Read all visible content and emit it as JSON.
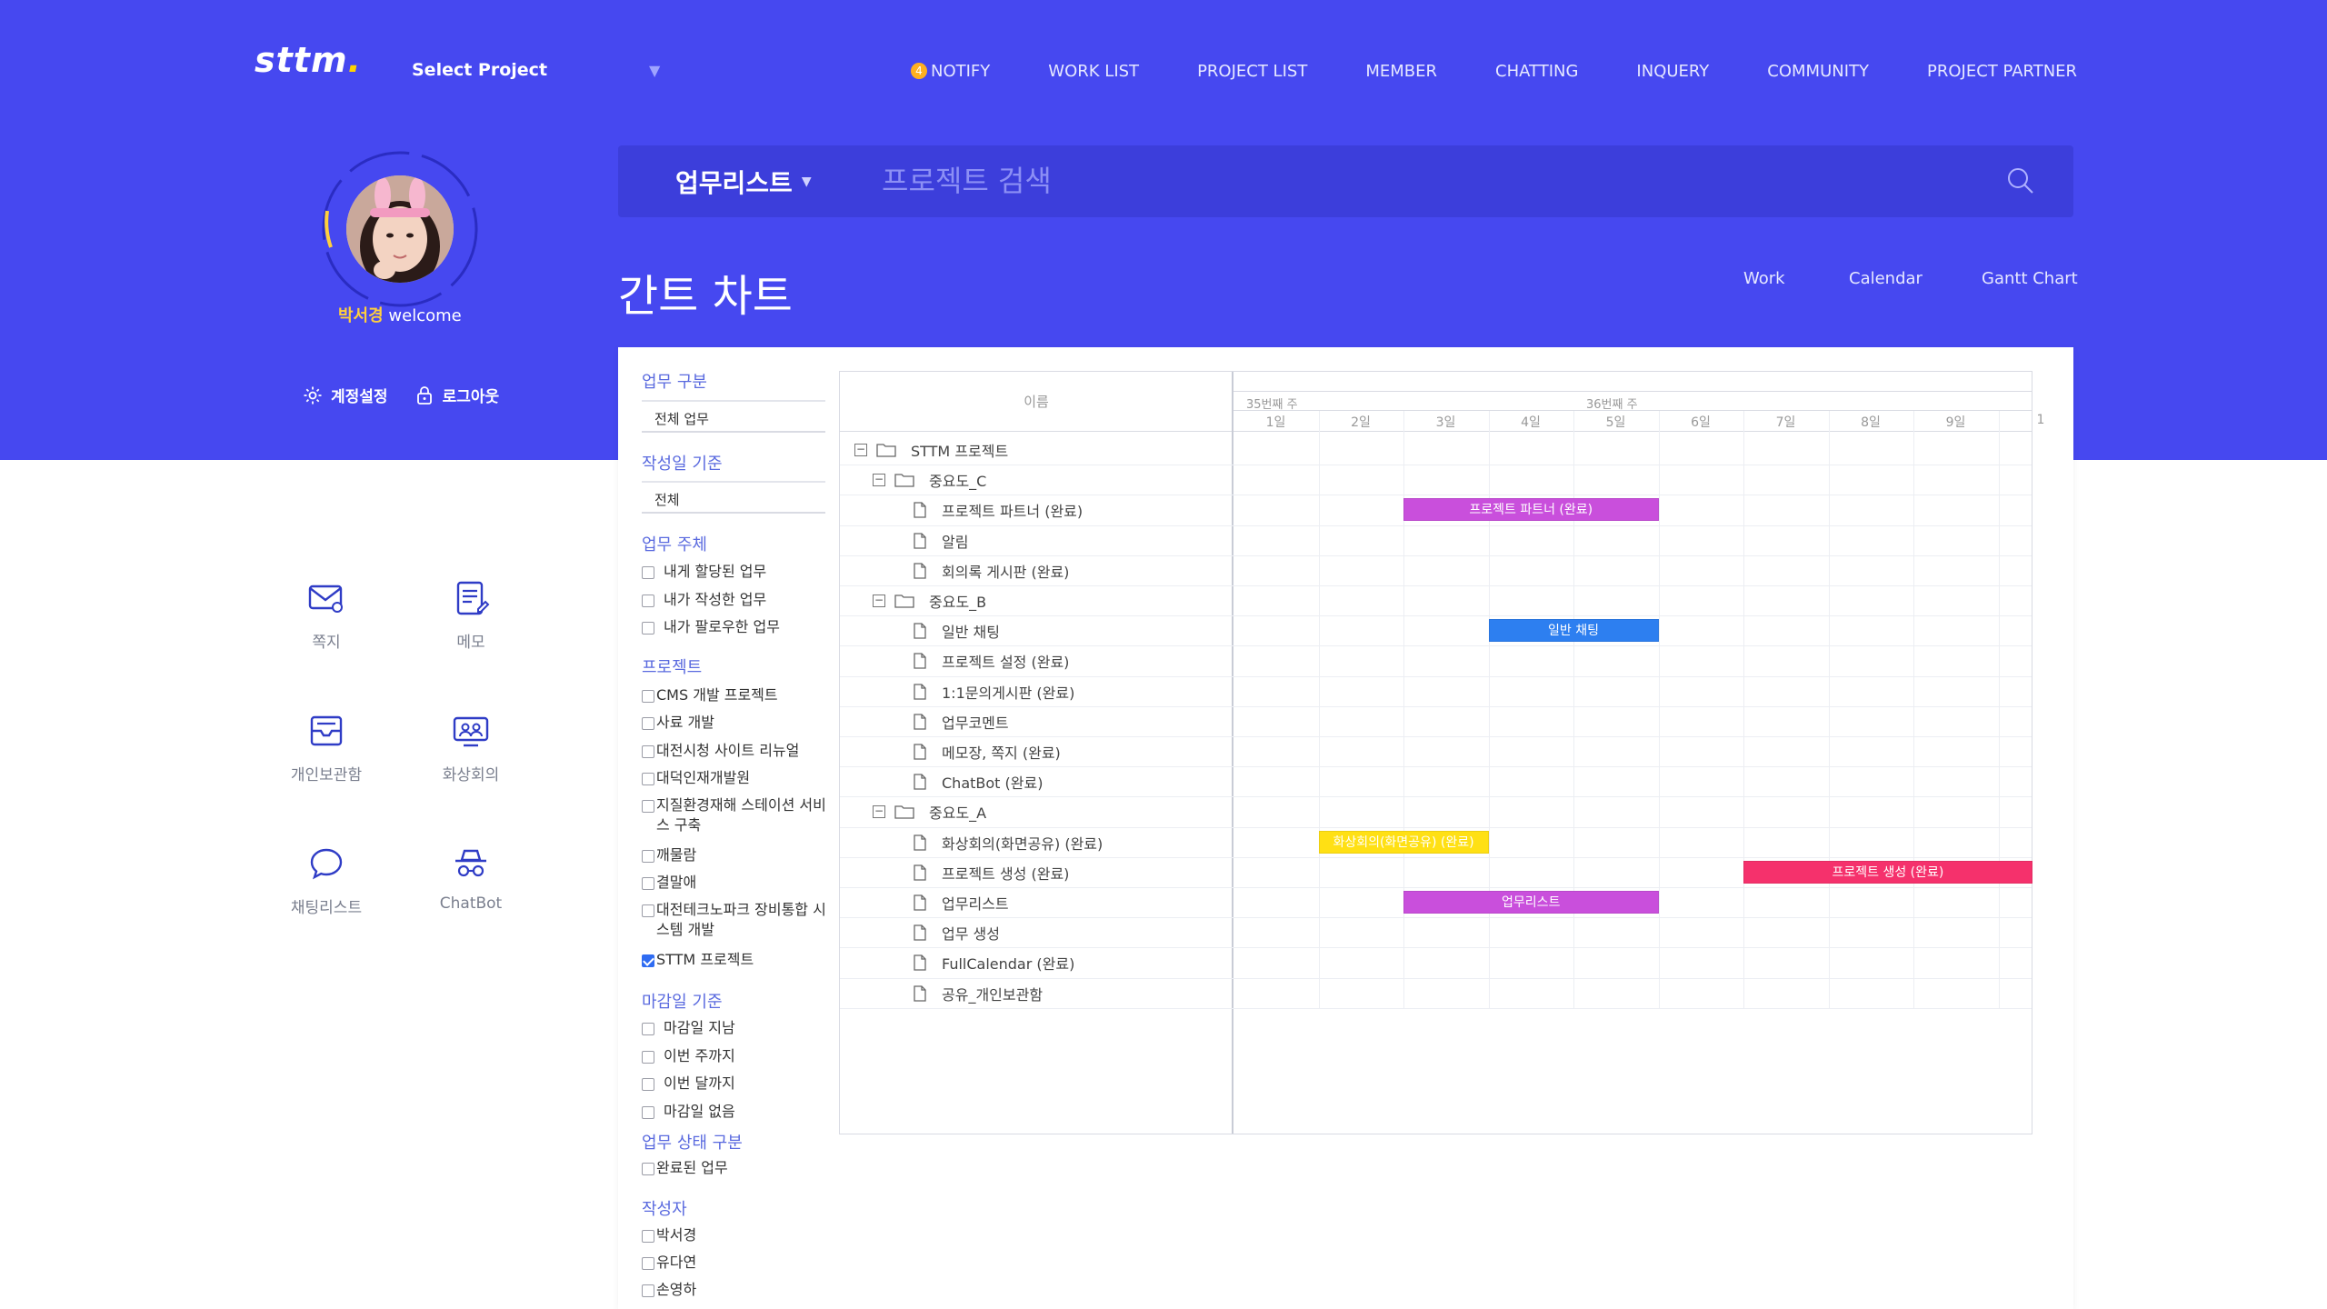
{
  "header": {
    "logo": "sttm",
    "logo_dot": ".",
    "project_select": "Select Project",
    "project_caret": "▼",
    "notify_count": "4",
    "nav": [
      "NOTIFY",
      "WORK LIST",
      "PROJECT LIST",
      "MEMBER",
      "CHATTING",
      "INQUERY",
      "COMMUNITY",
      "PROJECT PARTNER"
    ]
  },
  "profile": {
    "name": "박서경",
    "welcome": " welcome",
    "settings": "계정설정",
    "logout": "로그아웃"
  },
  "search": {
    "category": "업무리스트",
    "category_caret": "▼",
    "placeholder": "프로젝트 검색"
  },
  "page": {
    "title": "간트 차트",
    "views": [
      "Work",
      "Calendar",
      "Gantt Chart"
    ]
  },
  "quick_links": [
    "쪽지",
    "메모",
    "개인보관함",
    "화상회의",
    "채팅리스트",
    "ChatBot"
  ],
  "filters": {
    "type_title": "업무 구분",
    "type_value": "전체 업무",
    "date_title": "작성일 기준",
    "date_value": "전체",
    "subject_title": "업무 주체",
    "subject_options": [
      "내게 할당된 업무",
      "내가 작성한 업무",
      "내가 팔로우한 업무"
    ],
    "project_title": "프로젝트",
    "projects": [
      {
        "label": "CMS 개발 프로젝트",
        "checked": false
      },
      {
        "label": "사료 개발",
        "checked": false
      },
      {
        "label": "대전시청 사이트 리뉴얼",
        "checked": false
      },
      {
        "label": "대덕인재개발원",
        "checked": false
      },
      {
        "label": "지질환경재해 스테이션 서비스 구축",
        "checked": false
      },
      {
        "label": "깨물람",
        "checked": false
      },
      {
        "label": "결말애",
        "checked": false
      },
      {
        "label": "대전테크노파크 장비통합 시스템 개발",
        "checked": false
      },
      {
        "label": "STTM 프로젝트",
        "checked": true
      }
    ],
    "deadline_title": "마감일 기준",
    "deadline_options": [
      "마감일 지남",
      "이번 주까지",
      "이번 달까지",
      "마감일 없음"
    ],
    "status_title": "업무 상태 구분",
    "status_options": [
      "완료된 업무"
    ],
    "author_title": "작성자",
    "authors": [
      "박서경",
      "유다연",
      "손영하"
    ]
  },
  "gantt": {
    "name_header": "이름",
    "weeks": [
      "35번째 주",
      "36번째 주"
    ],
    "days": [
      "1일",
      "2일",
      "3일",
      "4일",
      "5일",
      "6일",
      "7일",
      "8일",
      "9일",
      "1"
    ],
    "rows": [
      {
        "label": "STTM 프로젝트",
        "level": 0,
        "folder": true
      },
      {
        "label": "중요도_C",
        "level": 1,
        "folder": true
      },
      {
        "label": "프로젝트 파트너 (완료)",
        "level": 2,
        "bar": {
          "start": 2,
          "end": 5,
          "color": "#c94fdc"
        }
      },
      {
        "label": "알림",
        "level": 2
      },
      {
        "label": "회의록 게시판 (완료)",
        "level": 2
      },
      {
        "label": "중요도_B",
        "level": 1,
        "folder": true
      },
      {
        "label": "일반 채팅",
        "level": 2,
        "bar": {
          "start": 3,
          "end": 5,
          "color": "#2d7ff0"
        }
      },
      {
        "label": "프로젝트 설정 (완료)",
        "level": 2
      },
      {
        "label": "1:1문의게시판 (완료)",
        "level": 2
      },
      {
        "label": "업무코멘트",
        "level": 2
      },
      {
        "label": "메모장, 쪽지 (완료)",
        "level": 2
      },
      {
        "label": "ChatBot (완료)",
        "level": 2
      },
      {
        "label": "중요도_A",
        "level": 1,
        "folder": true
      },
      {
        "label": "화상회의(화면공유) (완료)",
        "level": 2,
        "bar": {
          "start": 1,
          "end": 3,
          "color": "#ffe014"
        }
      },
      {
        "label": "프로젝트 생성 (완료)",
        "level": 2,
        "bar": {
          "start": 6,
          "end": 9.4,
          "color": "#f5316c"
        }
      },
      {
        "label": "업무리스트",
        "level": 2,
        "bar": {
          "start": 2,
          "end": 5,
          "color": "#c94fdc"
        }
      },
      {
        "label": "업무 생성",
        "level": 2
      },
      {
        "label": "FullCalendar (완료)",
        "level": 2
      },
      {
        "label": "공유_개인보관함",
        "level": 2
      }
    ]
  },
  "colors": {
    "brand": "#4648f0",
    "accent_yellow": "#ffcf3d",
    "filter_title": "#5a6adf"
  }
}
